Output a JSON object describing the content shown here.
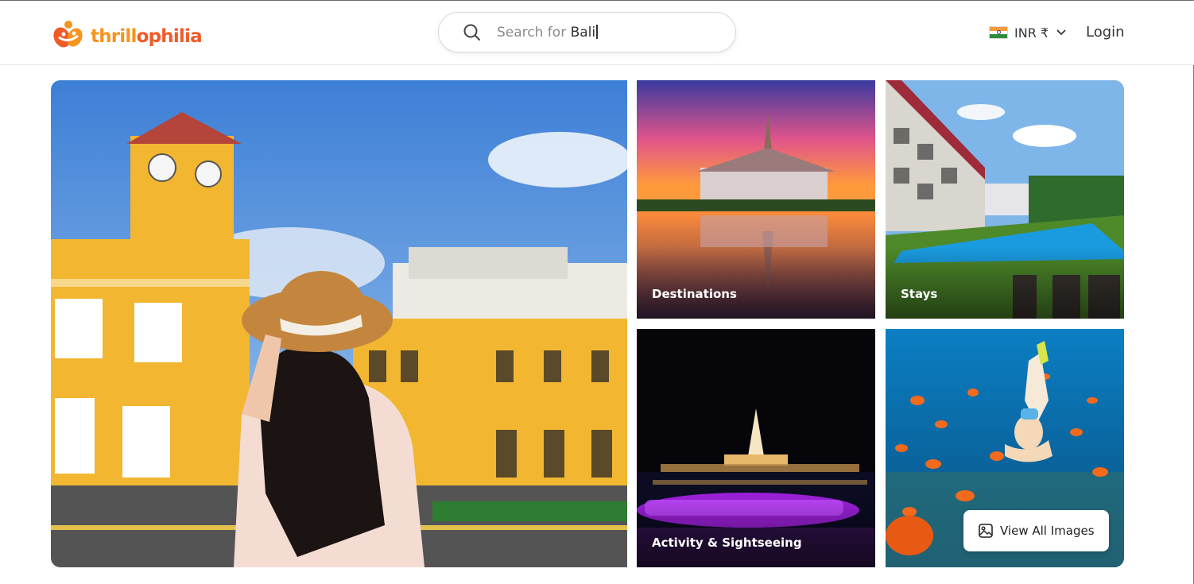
{
  "header": {
    "logo": {
      "part1": "thrill",
      "part2": "ophilia"
    },
    "search": {
      "prefix": "Search for ",
      "keyword": "Bali"
    },
    "currency": {
      "code": "INR",
      "symbol": "₹"
    },
    "login_label": "Login"
  },
  "gallery": {
    "tiles": [
      {
        "label": "Destinations"
      },
      {
        "label": "Stays"
      },
      {
        "label": "Activity & Sightseeing"
      }
    ],
    "view_all_label": "View All Images"
  },
  "colors": {
    "brand_orange": "#f7941d",
    "brand_red_orange": "#f15a29"
  }
}
